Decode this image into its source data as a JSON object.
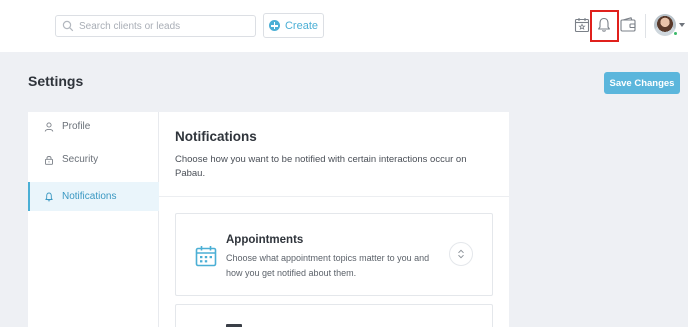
{
  "topbar": {
    "search_placeholder": "Search clients or leads",
    "create_label": "Create"
  },
  "page": {
    "title": "Settings",
    "save_label": "Save Changes"
  },
  "sidebar": {
    "items": [
      {
        "label": "Profile",
        "icon": "user-icon",
        "active": false
      },
      {
        "label": "Security",
        "icon": "lock-icon",
        "active": false
      },
      {
        "label": "Notifications",
        "icon": "bell-icon",
        "active": true
      }
    ]
  },
  "content": {
    "title": "Notifications",
    "description": "Choose how you want to be notified with certain interactions occur on Pabau.",
    "topics": [
      {
        "title": "Appointments",
        "description": "Choose what appointment topics matter to you and how you get notified about them.",
        "icon": "calendar-icon"
      }
    ]
  },
  "colors": {
    "accent": "#4bafd5",
    "highlight_box": "#e0201c",
    "background": "#eef0f4"
  }
}
